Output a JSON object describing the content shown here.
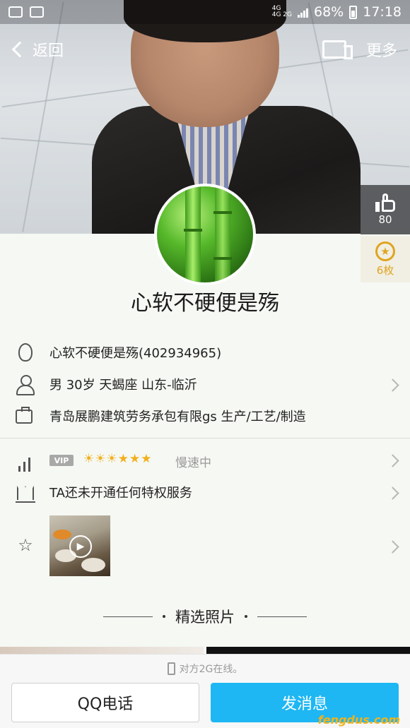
{
  "status_bar": {
    "battery": "68%",
    "time": "17:18",
    "net_top": "4G",
    "net_bottom": "4G 2G"
  },
  "nav": {
    "back_label": "返回",
    "more_label": "更多"
  },
  "profile": {
    "likes": "80",
    "badges": "6枚",
    "nickname": "心软不硬便是殇"
  },
  "info": {
    "qq": "心软不硬便是殇(402934965)",
    "basic": "男  30岁  天蝎座  山东-临沂",
    "job": "青岛展鹏建筑劳务承包有限gs 生产/工艺/制造",
    "vip_tag": "VIP",
    "level_icons": [
      "☀",
      "☀",
      "☀",
      "★",
      "★",
      "★"
    ],
    "speed": "慢速中",
    "privilege": "TA还未开通任何特权服务"
  },
  "section": {
    "featured_photos": "精选照片"
  },
  "bottom": {
    "online_status": "对方2G在线。",
    "call_label": "QQ电话",
    "message_label": "发消息",
    "watermark": "fengdus.com"
  },
  "colors": {
    "accent": "#1eb7f3",
    "gold": "#e0a420"
  }
}
